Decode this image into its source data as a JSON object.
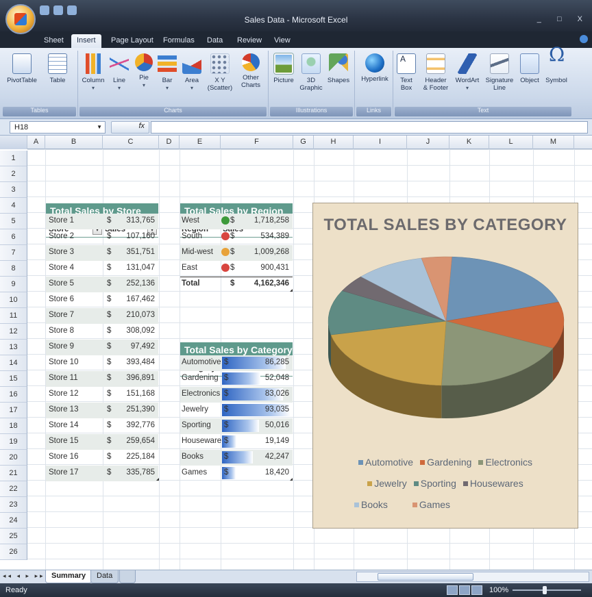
{
  "window": {
    "title": "Sales Data - Microsoft Excel",
    "controls": "_ □ X"
  },
  "tabs": [
    "Sheet",
    "Insert",
    "Page Layout",
    "Formulas",
    "Data",
    "Review",
    "View"
  ],
  "ribbon": {
    "tables": {
      "label": "Tables",
      "pivottable": "PivotTable",
      "table": "Table"
    },
    "charts": {
      "label": "Charts",
      "column": "Column",
      "line": "Line",
      "pie": "Pie",
      "bar": "Bar",
      "area": "Area",
      "scatter_1": "X Y",
      "scatter_2": "(Scatter)",
      "other_1": "Other",
      "other_2": "Charts"
    },
    "illustrations": {
      "label": "Illustrations",
      "picture": "Picture",
      "clipart_1": "3D",
      "clipart_2": "Graphic",
      "shapes": "Shapes"
    },
    "links": {
      "label": "Links",
      "hyperlink": "Hyperlink"
    },
    "text": {
      "label": "Text",
      "textbox_1": "Text",
      "textbox_2": "Box",
      "header_1": "Header",
      "header_2": "& Footer",
      "wordart": "WordArt",
      "signature_1": "Signature",
      "signature_2": "Line",
      "object": "Object",
      "symbol": "Symbol"
    }
  },
  "formula_bar": {
    "name_box": "H18",
    "fx": "fx",
    "value": ""
  },
  "columns": [
    "A",
    "B",
    "C",
    "D",
    "E",
    "F",
    "G",
    "H",
    "I",
    "J",
    "K",
    "L",
    "M"
  ],
  "rows": [
    "1",
    "2",
    "3",
    "4",
    "5",
    "6",
    "7",
    "8",
    "9",
    "10",
    "11",
    "12",
    "13",
    "14",
    "15",
    "16",
    "17",
    "18",
    "19",
    "20",
    "21",
    "22",
    "23",
    "24",
    "25",
    "26"
  ],
  "store_table": {
    "title": "Total Sales by Store",
    "headers": [
      "Store",
      "Sales"
    ],
    "currency": "$",
    "rows": [
      {
        "store": "Store 1",
        "sales": "313,765"
      },
      {
        "store": "Store 2",
        "sales": "107,160"
      },
      {
        "store": "Store 3",
        "sales": "351,751"
      },
      {
        "store": "Store 4",
        "sales": "131,047"
      },
      {
        "store": "Store 5",
        "sales": "252,136"
      },
      {
        "store": "Store 6",
        "sales": "167,462"
      },
      {
        "store": "Store 7",
        "sales": "210,073"
      },
      {
        "store": "Store 8",
        "sales": "308,092"
      },
      {
        "store": "Store 9",
        "sales": "97,492"
      },
      {
        "store": "Store 10",
        "sales": "393,484"
      },
      {
        "store": "Store 11",
        "sales": "396,891"
      },
      {
        "store": "Store 12",
        "sales": "151,168"
      },
      {
        "store": "Store 13",
        "sales": "251,390"
      },
      {
        "store": "Store 14",
        "sales": "392,776"
      },
      {
        "store": "Store 15",
        "sales": "259,654"
      },
      {
        "store": "Store 16",
        "sales": "225,184"
      },
      {
        "store": "Store 17",
        "sales": "335,785"
      }
    ]
  },
  "region_table": {
    "title": "Total Sales by Region",
    "headers": [
      "Region",
      "Sales"
    ],
    "currency": "$",
    "rows": [
      {
        "region": "West",
        "sales": "1,718,258",
        "status_color": "#3d9a3a"
      },
      {
        "region": "South",
        "sales": "534,389",
        "status_color": "#d8453f"
      },
      {
        "region": "Mid-west",
        "sales": "1,009,268",
        "status_color": "#e8a23a"
      },
      {
        "region": "East",
        "sales": "900,431",
        "status_color": "#d8453f"
      }
    ],
    "total_label": "Total",
    "total_value": "4,162,346"
  },
  "category_table": {
    "title": "Total Sales by Category",
    "headers": [
      "Category",
      "Sales"
    ],
    "currency": "$",
    "rows": [
      {
        "category": "Automotive",
        "sales": "86,285",
        "bar_fraction": 0.93
      },
      {
        "category": "Gardening",
        "sales": "52,048",
        "bar_fraction": 0.56
      },
      {
        "category": "Electronics",
        "sales": "83,026",
        "bar_fraction": 0.89
      },
      {
        "category": "Jewelry",
        "sales": "93,035",
        "bar_fraction": 1.0
      },
      {
        "category": "Sporting",
        "sales": "50,016",
        "bar_fraction": 0.54
      },
      {
        "category": "Houseware",
        "sales": "19,149",
        "bar_fraction": 0.21
      },
      {
        "category": "Books",
        "sales": "42,247",
        "bar_fraction": 0.45
      },
      {
        "category": "Games",
        "sales": "18,420",
        "bar_fraction": 0.2
      }
    ]
  },
  "chart_data": {
    "type": "pie",
    "title": "Total Sales by Category",
    "categories": [
      "Automotive",
      "Gardening",
      "Electronics",
      "Jewelry",
      "Sporting",
      "Housewares",
      "Books",
      "Games"
    ],
    "values": [
      86285,
      52048,
      83026,
      93035,
      50016,
      19149,
      42247,
      18420
    ],
    "colors": [
      "#6d93b6",
      "#cf6a3c",
      "#8c9678",
      "#c9a24a",
      "#5f8b83",
      "#716a70",
      "#a9c2d8",
      "#d99472"
    ],
    "legend_placement": "bottom",
    "three_d": true
  },
  "sheet_tabs": [
    "Summary",
    "Data"
  ],
  "status": {
    "text": "Ready",
    "zoom": "100%"
  }
}
